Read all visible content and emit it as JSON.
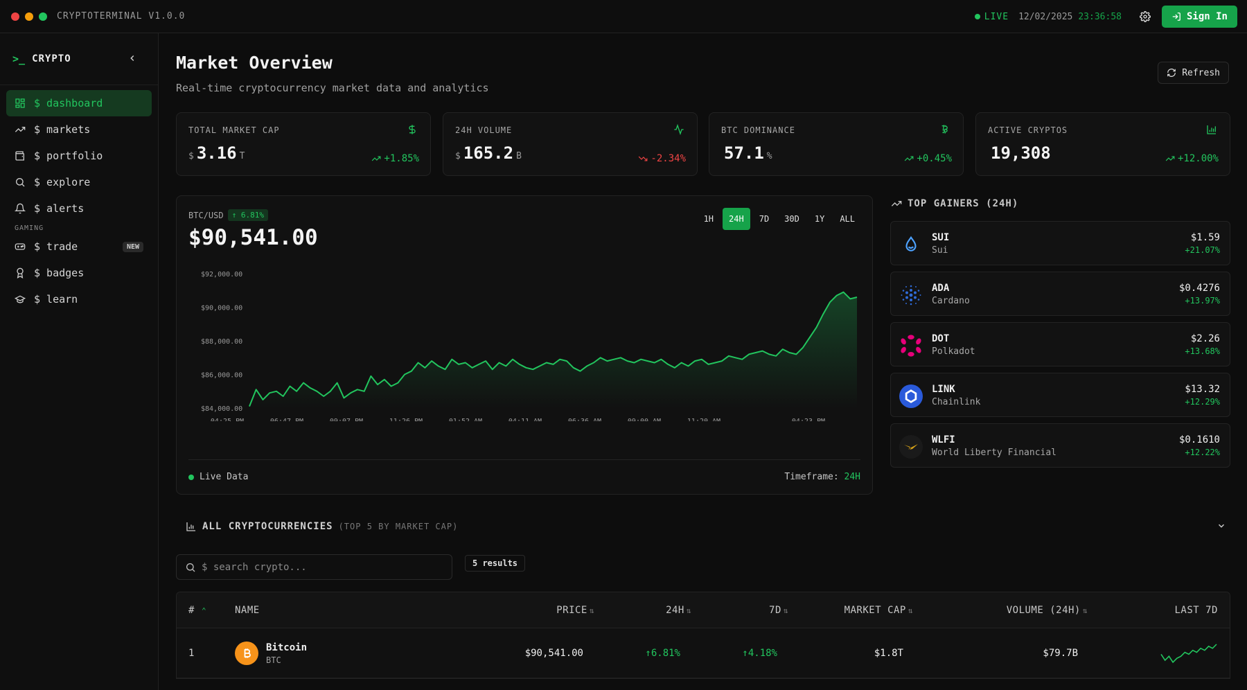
{
  "app": {
    "title": "CRYPTOTERMINAL V1.0.0",
    "live_label": "LIVE",
    "date": "12/02/2025",
    "time": "23:36:58",
    "signin_label": "Sign In"
  },
  "colors": {
    "accent": "#22c55e",
    "accent_dark": "#16a34a",
    "negative": "#ef4444",
    "bg": "#0d0d0d"
  },
  "sidebar": {
    "prompt": ">_",
    "brand": "CRYPTO",
    "items": [
      {
        "label": "$ dashboard",
        "icon": "grid-icon",
        "active": true
      },
      {
        "label": "$ markets",
        "icon": "trending-up-icon"
      },
      {
        "label": "$ portfolio",
        "icon": "wallet-icon"
      },
      {
        "label": "$ explore",
        "icon": "search-icon"
      },
      {
        "label": "$ alerts",
        "icon": "bell-icon"
      }
    ],
    "section_gaming": "GAMING",
    "gaming_items": [
      {
        "label": "$ trade",
        "icon": "gamepad-icon",
        "badge": "NEW"
      },
      {
        "label": "$ badges",
        "icon": "award-icon"
      },
      {
        "label": "$ learn",
        "icon": "graduation-cap-icon"
      }
    ]
  },
  "header": {
    "title": "Market Overview",
    "subtitle": "Real-time cryptocurrency market data and analytics",
    "refresh_label": "Refresh"
  },
  "stats": [
    {
      "label": "TOTAL MARKET CAP",
      "prefix": "$",
      "value": "3.16",
      "suffix": "T",
      "change": "+1.85%",
      "dir": "up",
      "icon": "dollar-icon"
    },
    {
      "label": "24H VOLUME",
      "prefix": "$",
      "value": "165.2",
      "suffix": "B",
      "change": "-2.34%",
      "dir": "down",
      "icon": "activity-icon"
    },
    {
      "label": "BTC DOMINANCE",
      "prefix": "",
      "value": "57.1",
      "suffix": "%",
      "change": "+0.45%",
      "dir": "up",
      "icon": "bitcoin-icon"
    },
    {
      "label": "ACTIVE CRYPTOS",
      "prefix": "",
      "value": "19,308",
      "suffix": "",
      "change": "+12.00%",
      "dir": "up",
      "icon": "bar-chart-icon"
    }
  ],
  "price_chart": {
    "pair": "BTC/USD",
    "change_badge": "6.81%",
    "price": "$90,541.00",
    "timeframes": [
      "1H",
      "24H",
      "7D",
      "30D",
      "1Y",
      "ALL"
    ],
    "active_timeframe": "24H",
    "footer_live": "Live Data",
    "footer_timeframe_label": "Timeframe:",
    "footer_timeframe_value": "24H"
  },
  "chart_data": {
    "type": "area",
    "y_ticks": [
      "$92,000.00",
      "$90,000.00",
      "$88,000.00",
      "$86,000.00",
      "$84,000.00"
    ],
    "ylim": [
      84000,
      92000
    ],
    "x_ticks": [
      "04:25 PM",
      "06:47 PM",
      "09:07 PM",
      "11:26 PM",
      "01:52 AM",
      "04:11 AM",
      "06:36 AM",
      "09:00 AM",
      "11:20 AM",
      "04:23 PM"
    ],
    "series": [
      {
        "values": [
          84100,
          85100,
          84500,
          84900,
          85000,
          84700,
          85300,
          85000,
          85500,
          85200,
          85000,
          84700,
          85000,
          85500,
          84600,
          84900,
          85100,
          85000,
          85900,
          85400,
          85700,
          85300,
          85500,
          86000,
          86200,
          86700,
          86400,
          86800,
          86500,
          86300,
          86900,
          86600,
          86700,
          86400,
          86600,
          86800,
          86300,
          86700,
          86500,
          86900,
          86600,
          86400,
          86300,
          86500,
          86700,
          86600,
          86900,
          86800,
          86400,
          86200,
          86500,
          86700,
          87000,
          86800,
          86900,
          87000,
          86800,
          86700,
          86900,
          86800,
          86700,
          86900,
          86600,
          86400,
          86700,
          86500,
          86800,
          86900,
          86600,
          86700,
          86800,
          87100,
          87000,
          86900,
          87200,
          87300,
          87400,
          87200,
          87100,
          87500,
          87300,
          87200,
          87600,
          88200,
          88800,
          89600,
          90300,
          90700,
          90900,
          90500,
          90600
        ]
      }
    ]
  },
  "gainers": {
    "title": "TOP GAINERS (24H)",
    "items": [
      {
        "symbol": "SUI",
        "name": "Sui",
        "price": "$1.59",
        "change": "+21.07%",
        "icon": "sui-drop-icon"
      },
      {
        "symbol": "ADA",
        "name": "Cardano",
        "price": "$0.4276",
        "change": "+13.97%",
        "icon": "cardano-icon"
      },
      {
        "symbol": "DOT",
        "name": "Polkadot",
        "price": "$2.26",
        "change": "+13.68%",
        "icon": "polkadot-icon"
      },
      {
        "symbol": "LINK",
        "name": "Chainlink",
        "price": "$13.32",
        "change": "+12.29%",
        "icon": "chainlink-icon"
      },
      {
        "symbol": "WLFI",
        "name": "World Liberty Financial",
        "price": "$0.1610",
        "change": "+12.22%",
        "icon": "wlfi-eagle-icon"
      }
    ]
  },
  "all_cryptos": {
    "title": "ALL CRYPTOCURRENCIES",
    "subtitle": "(TOP 5 BY MARKET CAP)",
    "search_placeholder": "$ search crypto...",
    "results": "5 results",
    "columns": [
      "#",
      "NAME",
      "PRICE",
      "24H",
      "7D",
      "MARKET CAP",
      "VOLUME (24H)",
      "LAST 7D"
    ],
    "rows": [
      {
        "rank": "1",
        "name": "Bitcoin",
        "symbol": "BTC",
        "price": "$90,541.00",
        "change_24h": "6.81%",
        "change_7d": "4.18%",
        "market_cap": "$1.8T",
        "volume": "$79.7B",
        "spark": [
          5,
          2,
          4,
          1,
          3,
          4,
          6,
          5,
          7,
          6,
          8,
          7,
          9,
          8,
          10
        ]
      }
    ]
  }
}
